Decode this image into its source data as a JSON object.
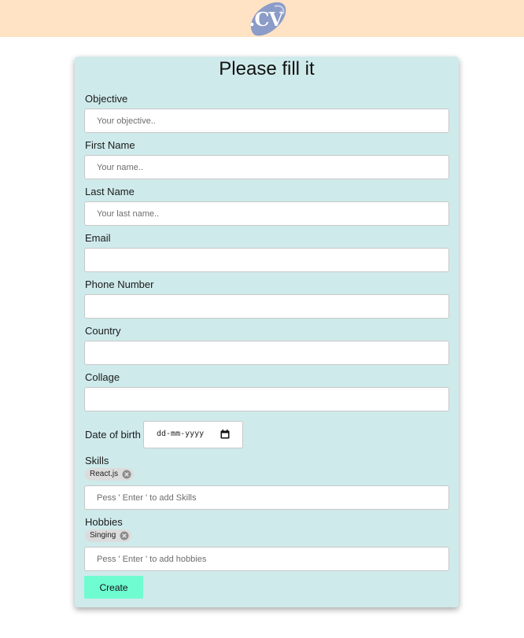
{
  "header": {
    "logo_text": ".CV"
  },
  "form": {
    "title": "Please fill it",
    "objective": {
      "label": "Objective",
      "placeholder": "Your objective..",
      "value": ""
    },
    "first_name": {
      "label": "First Name",
      "placeholder": "Your name..",
      "value": ""
    },
    "last_name": {
      "label": "Last Name",
      "placeholder": "Your last name..",
      "value": ""
    },
    "email": {
      "label": "Email",
      "placeholder": "",
      "value": ""
    },
    "phone": {
      "label": "Phone Number",
      "placeholder": "",
      "value": ""
    },
    "country": {
      "label": "Country",
      "placeholder": "",
      "value": ""
    },
    "collage": {
      "label": "Collage",
      "placeholder": "",
      "value": ""
    },
    "dob": {
      "label": "Date of birth",
      "placeholder": "dd-mm-yyyy"
    },
    "skills": {
      "label": "Skills",
      "tags": [
        "React.js"
      ],
      "placeholder": "Pess ' Enter ' to add Skills"
    },
    "hobbies": {
      "label": "Hobbies",
      "tags": [
        "Singing"
      ],
      "placeholder": "Pess ' Enter ' to add hobbies"
    },
    "create_label": "Create"
  },
  "colors": {
    "header_bg": "#ffe3c4",
    "card_bg": "#cfeaeb",
    "button_bg": "#6ffcd0",
    "logo": "#8c9cc8"
  }
}
